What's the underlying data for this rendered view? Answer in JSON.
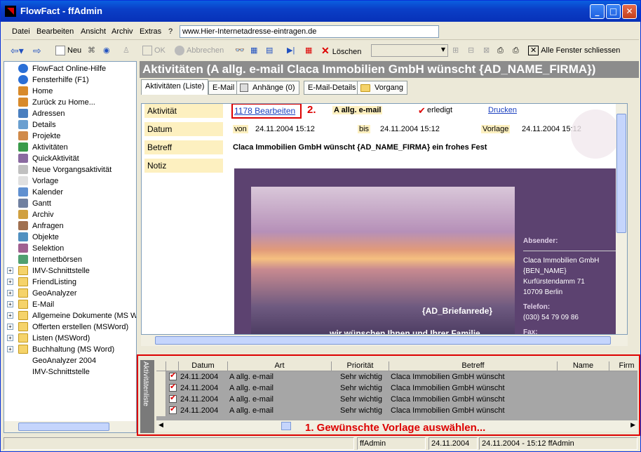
{
  "window": {
    "title": "FlowFact - ffAdmin",
    "min": "_",
    "max": "□",
    "close": "✕"
  },
  "menu": {
    "items": [
      "Datei",
      "Bearbeiten",
      "Ansicht",
      "Archiv",
      "Extras",
      "?"
    ],
    "url_value": "www.Hier-Internetadresse-eintragen.de"
  },
  "toolbar": {
    "neu": "Neu",
    "ok": "OK",
    "abbrechen": "Abbrechen",
    "loeschen": "Löschen",
    "alle_schliessen": "Alle Fenster schliessen"
  },
  "sidebar": {
    "items": [
      {
        "label": "FlowFact Online-Hilfe",
        "icon": "help-icon"
      },
      {
        "label": "Fensterhilfe (F1)",
        "icon": "help-icon"
      },
      {
        "label": "Home",
        "icon": "home-icon"
      },
      {
        "label": "Zurück zu Home...",
        "icon": "back-home-icon"
      },
      {
        "label": "Adressen",
        "icon": "address-icon"
      },
      {
        "label": "Details",
        "icon": "details-icon"
      },
      {
        "label": "Projekte",
        "icon": "project-icon"
      },
      {
        "label": "Aktivitäten",
        "icon": "activity-icon"
      },
      {
        "label": "QuickAktivität",
        "icon": "quick-activity-icon"
      },
      {
        "label": "Neue Vorgangsaktivität",
        "icon": "new-process-icon"
      },
      {
        "label": "Vorlage",
        "icon": "template-icon"
      },
      {
        "label": "Kalender",
        "icon": "calendar-icon"
      },
      {
        "label": "Gantt",
        "icon": "gantt-icon"
      },
      {
        "label": "Archiv",
        "icon": "archive-icon"
      },
      {
        "label": "Anfragen",
        "icon": "request-icon"
      },
      {
        "label": "Objekte",
        "icon": "object-icon"
      },
      {
        "label": "Selektion",
        "icon": "selection-icon"
      },
      {
        "label": "Internetbörsen",
        "icon": "internet-icon"
      },
      {
        "label": "IMV-Schnittstelle",
        "icon": "folder-icon"
      },
      {
        "label": "FriendListing",
        "icon": "folder-icon"
      },
      {
        "label": "GeoAnalyzer",
        "icon": "folder-icon"
      },
      {
        "label": "E-Mail",
        "icon": "folder-icon"
      },
      {
        "label": "Allgemeine Dokumente (MS Wo",
        "icon": "folder-icon"
      },
      {
        "label": "Offerten erstellen (MSWord)",
        "icon": "folder-icon"
      },
      {
        "label": "Listen (MSWord)",
        "icon": "folder-icon"
      },
      {
        "label": "Buchhaltung (MS Word)",
        "icon": "folder-icon"
      },
      {
        "label": "GeoAnalyzer 2004",
        "icon": ""
      },
      {
        "label": "IMV-Schnittstelle",
        "icon": ""
      }
    ]
  },
  "main": {
    "header": "Aktivitäten (A allg. e-mail Claca Immobilien GmbH wünscht {AD_NAME_FIRMA})",
    "tabs": [
      "Aktivitäten (Liste)",
      "E-Mail",
      "Anhänge (0)",
      "E-Mail-Details",
      "Vorgang"
    ],
    "fields": {
      "aktivitaet_label": "Aktivität",
      "datum_label": "Datum",
      "betreff_label": "Betreff",
      "notiz_label": "Notiz",
      "bearbeiten": "1178  Bearbeiten",
      "step2": "2.",
      "art": "A allg. e-mail",
      "erledigt": "erledigt",
      "drucken": "Drucken",
      "von": "von",
      "von_val": "24.11.2004 15:12",
      "bis": "bis",
      "bis_val": "24.11.2004 15:12",
      "vorlage": "Vorlage",
      "vorlage_val": "24.11.2004 15:12",
      "betreff_val": "Claca Immobilien GmbH wünscht {AD_NAME_FIRMA} ein frohes Fest"
    },
    "email": {
      "briefanrede": "{AD_Briefanrede}",
      "wunsch": "wir wünschen Ihnen und Ihrer Familie",
      "absender_label": "Absender:",
      "absender_lines": [
        "Claca Immobilien GmbH",
        "{BEN_NAME}",
        "Kurfürstendamm 71",
        "10709 Berlin"
      ],
      "telefon_label": "Telefon:",
      "telefon": "(030) 54 79 09 86",
      "fax_label": "Fax:"
    }
  },
  "bottom": {
    "label": "Aktivitätenliste",
    "headers": [
      "Datum",
      "Art",
      "Priorität",
      "Betreff",
      "Name",
      "Firm"
    ],
    "rows": [
      [
        "24.11.2004",
        "A allg. e-mail",
        "Sehr wichtig",
        "Claca Immobilien GmbH wünscht"
      ],
      [
        "24.11.2004",
        "A allg. e-mail",
        "Sehr wichtig",
        "Claca Immobilien GmbH wünscht"
      ],
      [
        "24.11.2004",
        "A allg. e-mail",
        "Sehr wichtig",
        "Claca Immobilien GmbH wünscht"
      ],
      [
        "24.11.2004",
        "A allg. e-mail",
        "Sehr wichtig",
        "Claca Immobilien GmbH wünscht"
      ]
    ],
    "note": "1. Gewünschte Vorlage auswählen..."
  },
  "status": {
    "user": "ffAdmin",
    "date": "24.11.2004",
    "info": "24.11.2004 - 15:12 ffAdmin"
  },
  "colors": {
    "accent": "#d00000",
    "header_bg": "#8c8c8c",
    "field_bg": "#fdf0c0",
    "mail_bg": "#5c4270"
  }
}
